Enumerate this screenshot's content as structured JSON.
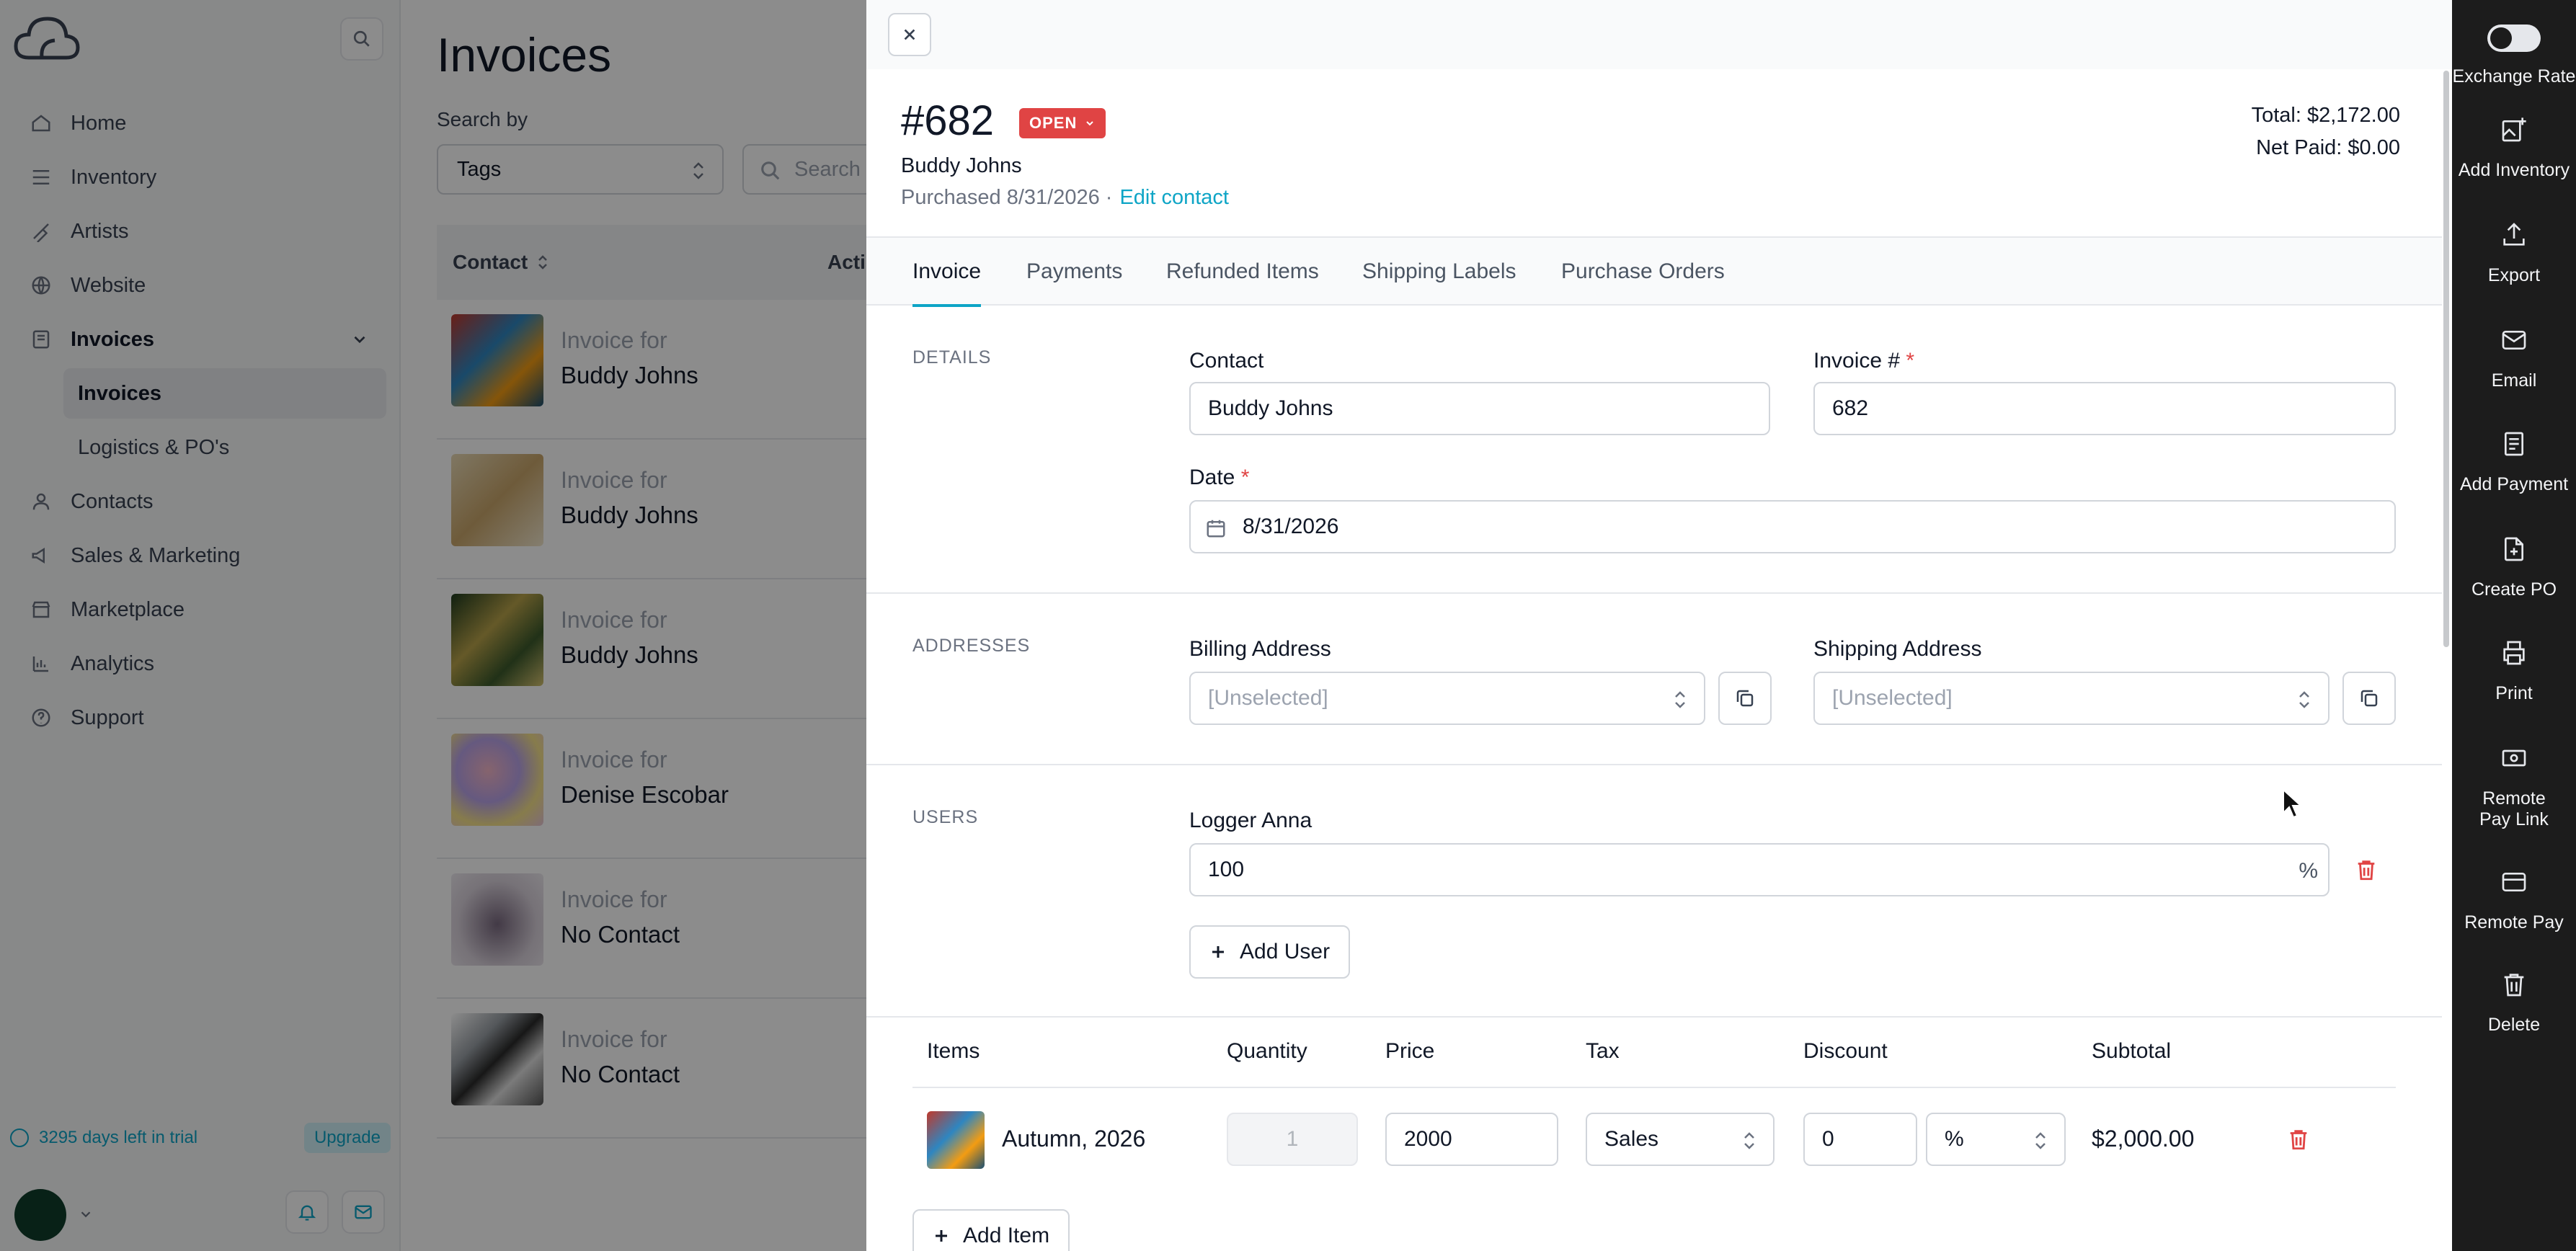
{
  "sidebar": {
    "nav": [
      {
        "label": "Home",
        "icon": "home-icon"
      },
      {
        "label": "Inventory",
        "icon": "inventory-icon"
      },
      {
        "label": "Artists",
        "icon": "brush-icon"
      },
      {
        "label": "Website",
        "icon": "globe-icon"
      },
      {
        "label": "Invoices",
        "icon": "invoice-icon"
      },
      {
        "label": "Invoices"
      },
      {
        "label": "Logistics & PO's"
      },
      {
        "label": "Contacts",
        "icon": "user-icon"
      },
      {
        "label": "Sales & Marketing",
        "icon": "megaphone-icon"
      },
      {
        "label": "Marketplace",
        "icon": "store-icon"
      },
      {
        "label": "Analytics",
        "icon": "chart-icon"
      },
      {
        "label": "Support",
        "icon": "help-icon"
      }
    ],
    "trial_text": "3295 days left in trial",
    "upgrade_label": "Upgrade"
  },
  "main": {
    "title": "Invoices",
    "search_by_label": "Search by",
    "tags_value": "Tags",
    "search_placeholder": "Search",
    "col_contact": "Contact",
    "col_actions": "Actio",
    "rows": [
      {
        "line1": "Invoice for",
        "line2": "Buddy Johns"
      },
      {
        "line1": "Invoice for",
        "line2": "Buddy Johns"
      },
      {
        "line1": "Invoice for",
        "line2": "Buddy Johns"
      },
      {
        "line1": "Invoice for",
        "line2": "Denise Escobar"
      },
      {
        "line1": "Invoice for",
        "line2": "No Contact"
      },
      {
        "line1": "Invoice for",
        "line2": "No Contact"
      }
    ]
  },
  "drawer": {
    "invoice_number": "#682",
    "status": "OPEN",
    "contact_name": "Buddy Johns",
    "purchased": "Purchased 8/31/2026 ·",
    "edit_contact": "Edit contact",
    "total": "Total: $2,172.00",
    "net_paid": "Net Paid: $0.00",
    "tabs": [
      "Invoice",
      "Payments",
      "Refunded Items",
      "Shipping Labels",
      "Purchase Orders"
    ],
    "details": {
      "section_label": "DETAILS",
      "contact_label": "Contact",
      "contact_value": "Buddy Johns",
      "invoice_label": "Invoice #",
      "invoice_value": "682",
      "date_label": "Date",
      "date_value": "8/31/2026",
      "required_mark": "*"
    },
    "addresses": {
      "section_label": "ADDRESSES",
      "billing_label": "Billing Address",
      "billing_value": "[Unselected]",
      "shipping_label": "Shipping Address",
      "shipping_value": "[Unselected]"
    },
    "users": {
      "section_label": "USERS",
      "user_name": "Logger Anna",
      "user_value": "100",
      "user_unit": "%",
      "add_user_label": "Add User"
    },
    "items": {
      "headers": [
        "Items",
        "Quantity",
        "Price",
        "Tax",
        "Discount",
        "Subtotal"
      ],
      "rows": [
        {
          "name": "Autumn, 2026",
          "quantity": "1",
          "price": "2000",
          "tax": "Sales",
          "discount": "0",
          "discount_type": "%",
          "subtotal": "$2,000.00"
        }
      ],
      "add_item_label": "Add Item"
    }
  },
  "rail": [
    {
      "label": "Exchange Rate",
      "icon": "toggle-icon"
    },
    {
      "label": "Add Inventory",
      "icon": "add-image-icon"
    },
    {
      "label": "Export",
      "icon": "export-icon"
    },
    {
      "label": "Email",
      "icon": "mail-icon"
    },
    {
      "label": "Add Payment",
      "icon": "receipt-icon"
    },
    {
      "label": "Create PO",
      "icon": "create-po-icon"
    },
    {
      "label": "Print",
      "icon": "printer-icon"
    },
    {
      "label": "Remote Pay Link",
      "icon": "cash-icon"
    },
    {
      "label": "Remote Pay",
      "icon": "card-icon"
    },
    {
      "label": "Delete",
      "icon": "trash-icon"
    }
  ],
  "colors": {
    "accent": "#0ea5c6",
    "danger": "#e04444",
    "rail_bg": "#1c1c1c"
  }
}
